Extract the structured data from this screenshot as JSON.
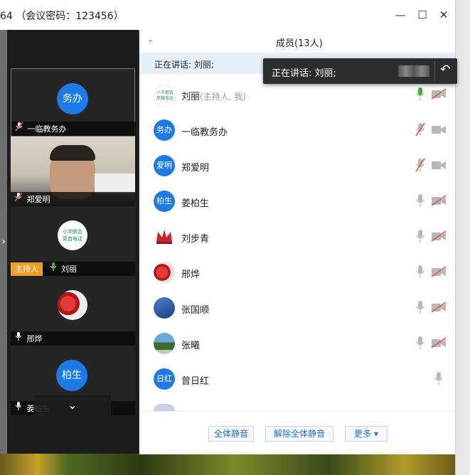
{
  "window": {
    "title": "64 （会议密码：123456）",
    "minimize_glyph": "—",
    "maximize_glyph": "☐",
    "close_glyph": "✕"
  },
  "panel": {
    "collapse_glyph": "⌄",
    "header": "成员(13人)",
    "speaking": "正在讲话: 刘丽;",
    "tooltip": {
      "text": "正在讲话: 刘丽;",
      "back_glyph": "↶"
    }
  },
  "members": [
    {
      "name": "刘丽",
      "suffix": "(主持人, 我)",
      "avatar": "logo",
      "avatar_text": "",
      "mic": "active",
      "cam": "off"
    },
    {
      "name": "一临教务办",
      "suffix": "",
      "avatar": "blue",
      "avatar_text": "务办",
      "mic": "muted",
      "cam": "on"
    },
    {
      "name": "郑爱明",
      "suffix": "",
      "avatar": "blue",
      "avatar_text": "爱明",
      "mic": "muted",
      "cam": "on"
    },
    {
      "name": "姜柏生",
      "suffix": "",
      "avatar": "blue",
      "avatar_text": "柏生",
      "mic": "on",
      "cam": "off"
    },
    {
      "name": "刘步青",
      "suffix": "",
      "avatar": "crown",
      "avatar_text": "",
      "mic": "on",
      "cam": "off"
    },
    {
      "name": "邢烨",
      "suffix": "",
      "avatar": "fruit",
      "avatar_text": "",
      "mic": "on",
      "cam": "off"
    },
    {
      "name": "张国顺",
      "suffix": "",
      "avatar": "sky",
      "avatar_text": "",
      "mic": "on",
      "cam": "off"
    },
    {
      "name": "张曦",
      "suffix": "",
      "avatar": "tree",
      "avatar_text": "",
      "mic": "on",
      "cam": "off"
    },
    {
      "name": "曾日红",
      "suffix": "",
      "avatar": "blue",
      "avatar_text": "日红",
      "mic": "on",
      "cam": "none"
    }
  ],
  "footer": {
    "mute_all": "全体静音",
    "unmute_all": "解除全体静音",
    "more": "更多 ▾"
  },
  "tiles": [
    {
      "label": "一临教务办",
      "avatar_text": "务办"
    },
    {
      "label": "郑爱明",
      "avatar_text": ""
    },
    {
      "host_tag": "主持人",
      "label": "刘丽",
      "avatar_text": ""
    },
    {
      "label": "邢烨",
      "avatar_text": ""
    },
    {
      "label": "姜柏生",
      "avatar_text": "柏生"
    }
  ],
  "left_controls": {
    "expand_glyph": "⌄",
    "side_arrow_glyph": "›"
  },
  "colors": {
    "accent_blue": "#1e7ae6",
    "mic_active": "#3cb034",
    "muted_red": "#e0584a",
    "host_tag": "#f0a020"
  }
}
